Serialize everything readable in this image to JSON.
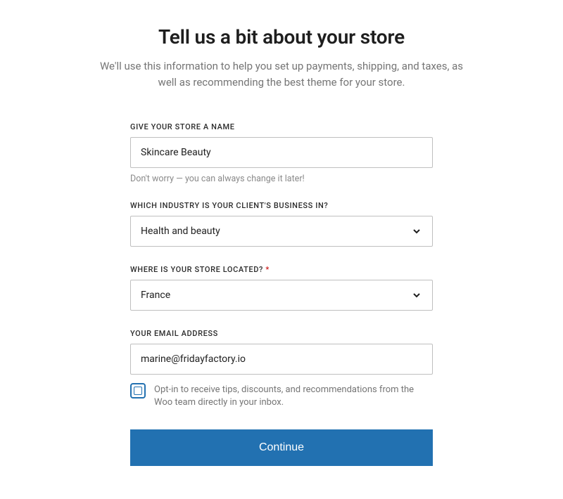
{
  "header": {
    "title": "Tell us a bit about your store",
    "subtitle": "We'll use this information to help you set up payments, shipping, and taxes, as well as recommending the best theme for your store."
  },
  "fields": {
    "store_name": {
      "label": "GIVE YOUR STORE A NAME",
      "value": "Skincare Beauty",
      "helper": "Don't worry — you can always change it later!"
    },
    "industry": {
      "label": "WHICH INDUSTRY IS YOUR CLIENT'S BUSINESS IN?",
      "value": "Health and beauty"
    },
    "location": {
      "label": "WHERE IS YOUR STORE LOCATED?",
      "required_mark": "*",
      "value": "France"
    },
    "email": {
      "label": "YOUR EMAIL ADDRESS",
      "value": "marine@fridayfactory.io"
    },
    "optin": {
      "label": "Opt-in to receive tips, discounts, and recommendations from the Woo team directly in your inbox."
    }
  },
  "actions": {
    "continue": "Continue"
  }
}
